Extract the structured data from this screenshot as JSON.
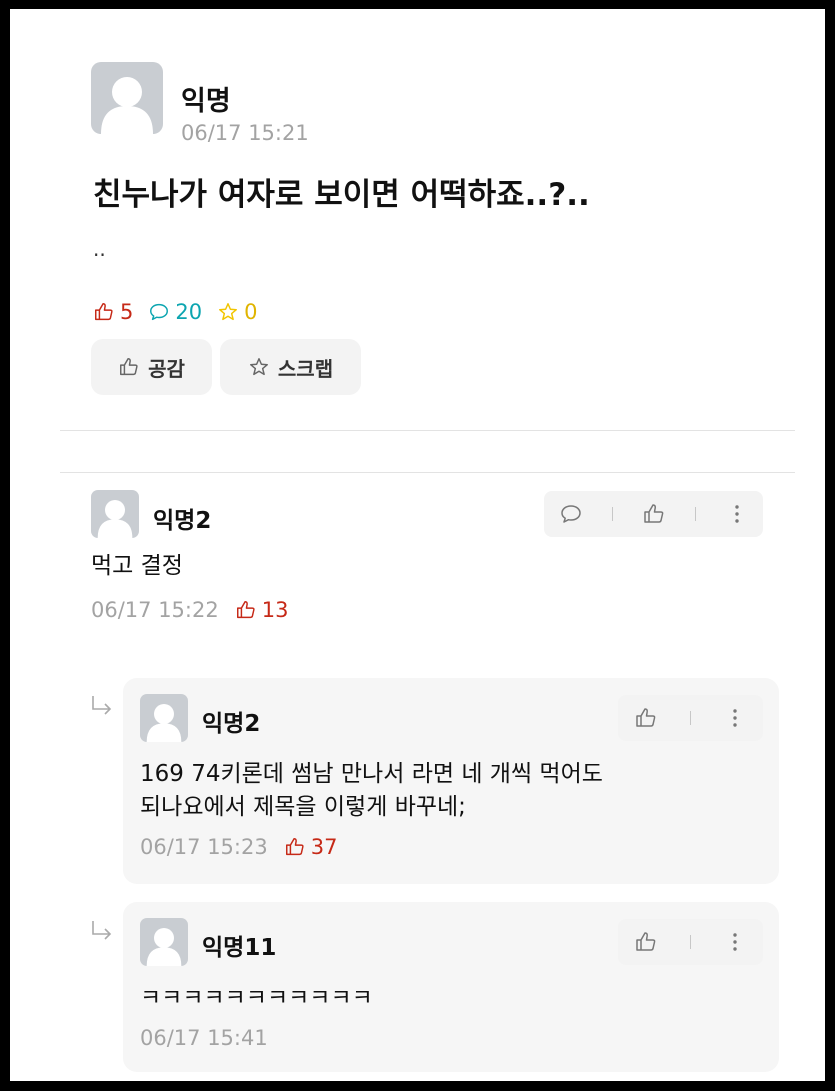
{
  "post": {
    "author": "익명",
    "time": "06/17 15:21",
    "title": "친누나가 여자로 보이면 어떡하죠..?..",
    "body": "..",
    "likes": "5",
    "comments": "20",
    "scraps": "0",
    "like_button": "공감",
    "scrap_button": "스크랩"
  },
  "comments": [
    {
      "author": "익명2",
      "text": "먹고 결정",
      "time": "06/17 15:22",
      "votes": "13"
    }
  ],
  "replies": [
    {
      "author": "익명2",
      "text_line1": "169 74키론데 썸남 만나서 라면 네 개씩 먹어도",
      "text_line2": "되나요에서 제목을 이렇게 바꾸네;",
      "time": "06/17 15:23",
      "votes": "37"
    },
    {
      "author": "익명11",
      "text_line1": "ㅋㅋㅋㅋㅋㅋㅋㅋㅋㅋㅋ",
      "time": "06/17 15:41"
    }
  ],
  "colors": {
    "vote_red": "#c62917",
    "comment_teal": "#0ca5b0",
    "scrap_yellow": "#f2c500",
    "avatar_gray": "#c9cdd2"
  },
  "icons": [
    "thumbs-up-icon",
    "speech-bubble-icon",
    "star-icon",
    "more-vertical-icon",
    "reply-arrow-icon",
    "avatar-placeholder-icon"
  ]
}
